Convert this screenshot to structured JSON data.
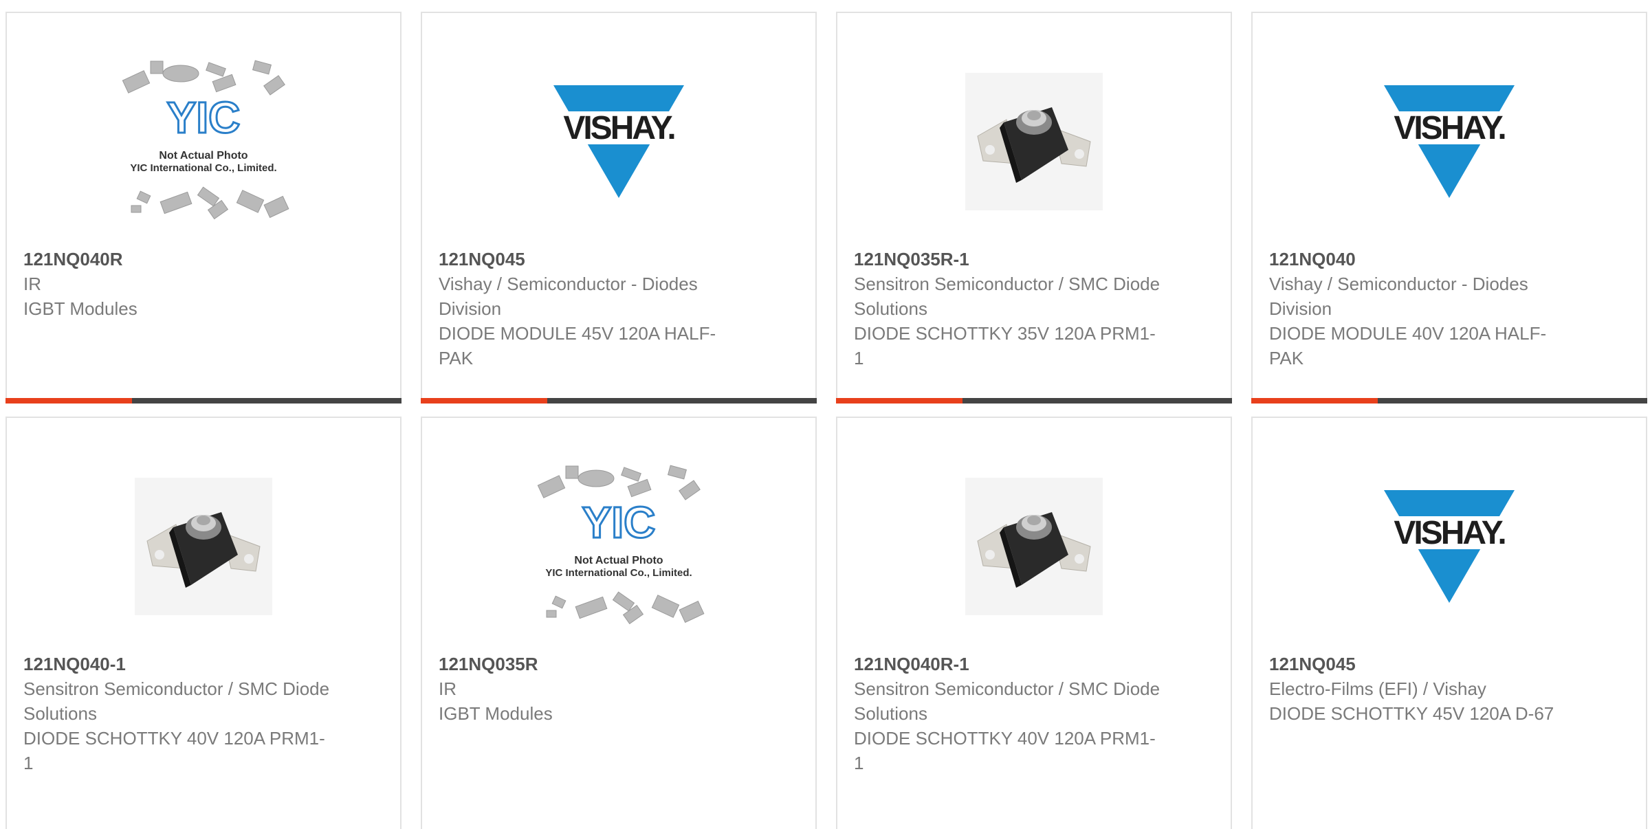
{
  "products": [
    {
      "part": "121NQ040R",
      "manufacturer": "IR",
      "description": "IGBT Modules",
      "image": "yic-placeholder"
    },
    {
      "part": "121NQ045",
      "manufacturer": "Vishay / Semiconductor - Diodes Division",
      "description": "DIODE MODULE 45V 120A HALF-PAK",
      "image": "vishay-logo"
    },
    {
      "part": "121NQ035R-1",
      "manufacturer": "Sensitron Semiconductor / SMC Diode Solutions",
      "description": "DIODE SCHOTTKY 35V 120A PRM1-1",
      "image": "diode-module-photo"
    },
    {
      "part": "121NQ040",
      "manufacturer": "Vishay / Semiconductor - Diodes Division",
      "description": "DIODE MODULE 40V 120A HALF-PAK",
      "image": "vishay-logo"
    },
    {
      "part": "121NQ040-1",
      "manufacturer": "Sensitron Semiconductor / SMC Diode Solutions",
      "description": "DIODE SCHOTTKY 40V 120A PRM1-1",
      "image": "diode-module-photo"
    },
    {
      "part": "121NQ035R",
      "manufacturer": "IR",
      "description": "IGBT Modules",
      "image": "yic-placeholder"
    },
    {
      "part": "121NQ040R-1",
      "manufacturer": "Sensitron Semiconductor / SMC Diode Solutions",
      "description": "DIODE SCHOTTKY 40V 120A PRM1-1",
      "image": "diode-module-photo"
    },
    {
      "part": "121NQ045",
      "manufacturer": "Electro-Films (EFI) / Vishay",
      "description": "DIODE SCHOTTKY 45V 120A D-67",
      "image": "vishay-logo"
    }
  ],
  "placeholder": {
    "logo_text": "YIC",
    "line1": "Not Actual Photo",
    "line2": "YIC International Co., Limited."
  },
  "vishay_logo_text": "VISHAY.",
  "colors": {
    "accent": "#e8401c",
    "bar": "#444444",
    "vishay_blue": "#1a8fd0",
    "border": "#e2e2e2"
  }
}
